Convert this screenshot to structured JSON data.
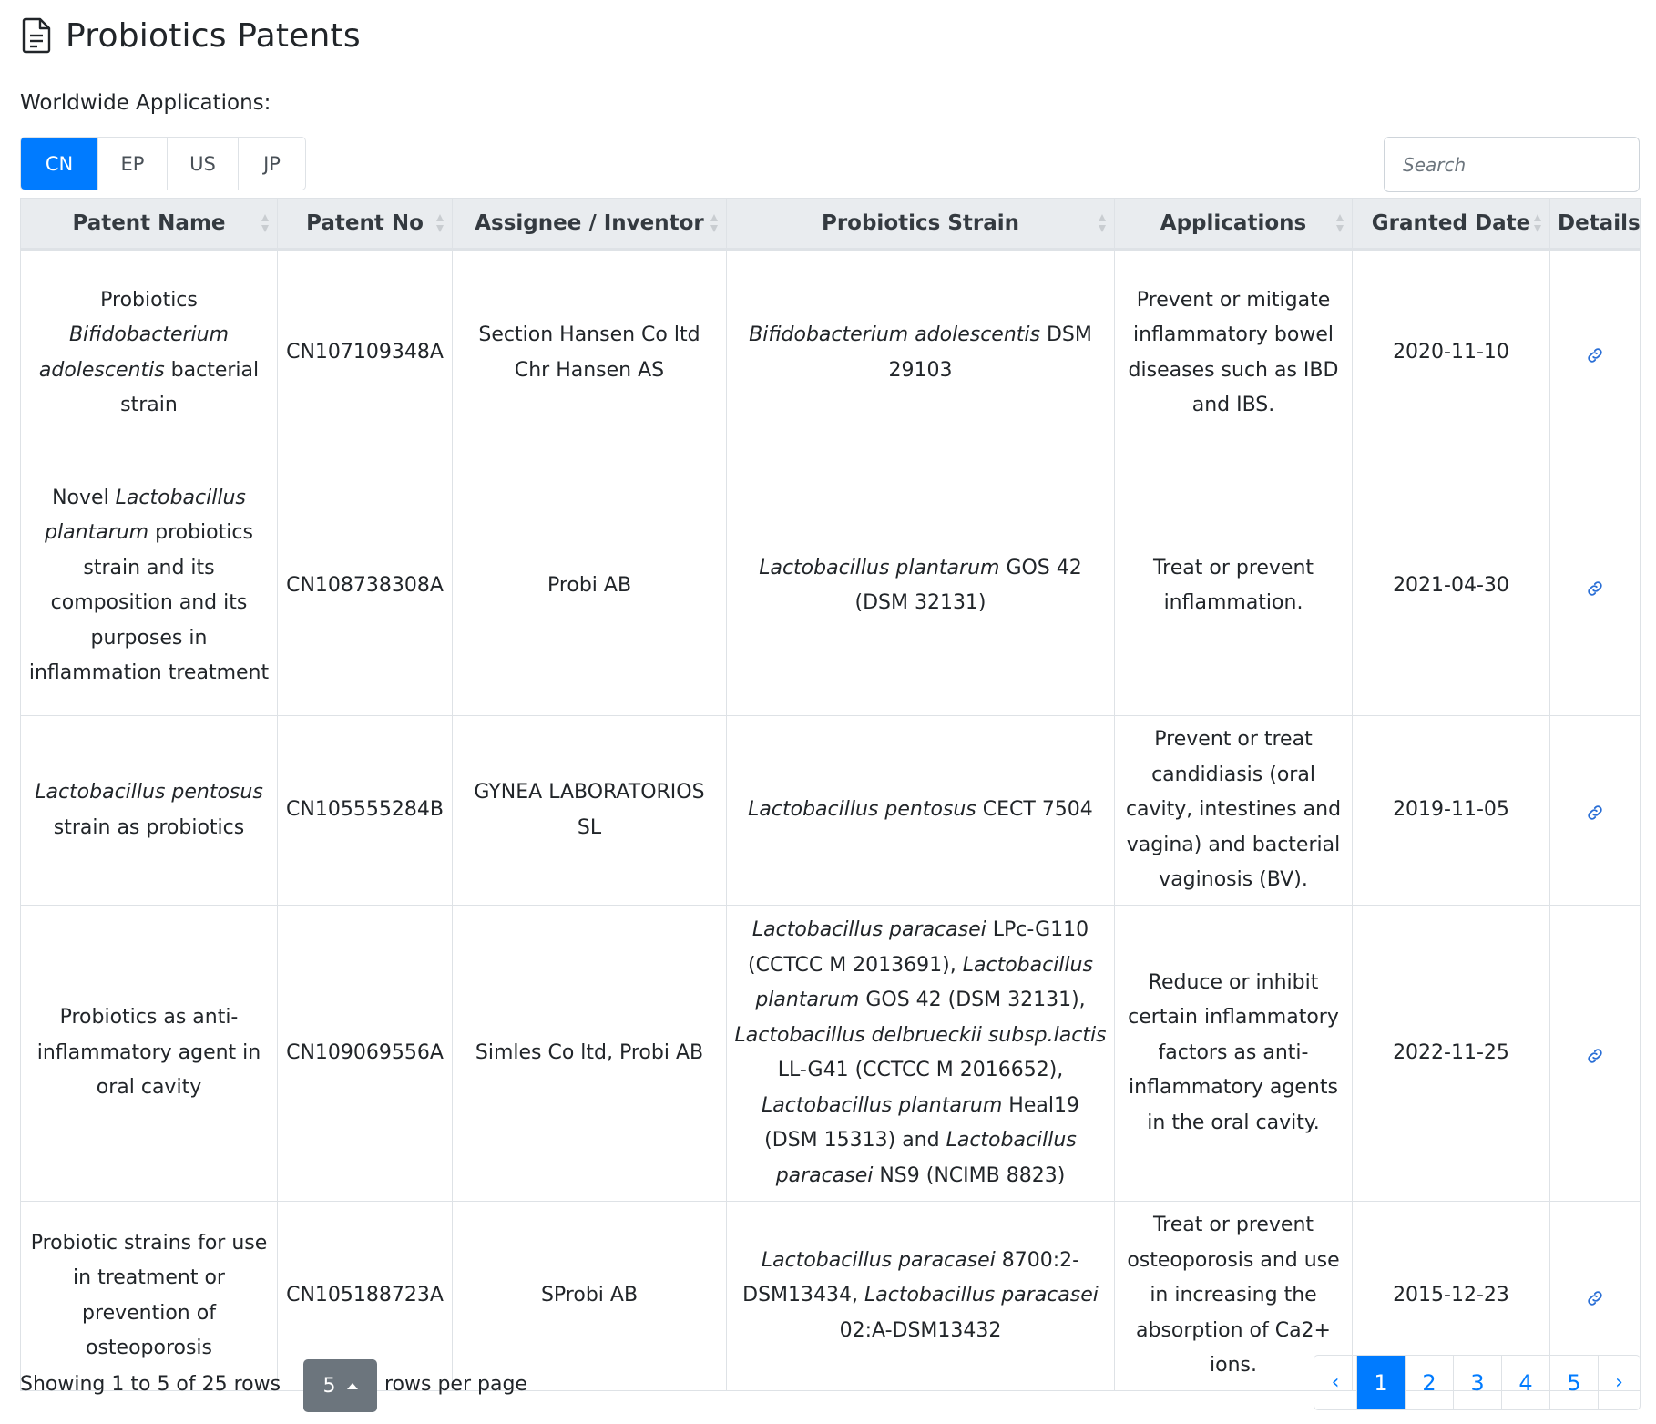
{
  "header": {
    "icon": "file-text-icon",
    "title": "Probiotics Patents",
    "subtitle": "Worldwide Applications:"
  },
  "region_tabs": [
    {
      "label": "CN",
      "active": true
    },
    {
      "label": "EP",
      "active": false
    },
    {
      "label": "US",
      "active": false
    },
    {
      "label": "JP",
      "active": false
    }
  ],
  "search": {
    "placeholder": "Search",
    "value": ""
  },
  "table": {
    "columns": [
      {
        "label": "Patent Name",
        "sortable": true
      },
      {
        "label": "Patent No",
        "sortable": true
      },
      {
        "label": "Assignee / Inventor",
        "sortable": true
      },
      {
        "label": "Probiotics Strain",
        "sortable": true
      },
      {
        "label": "Applications",
        "sortable": true
      },
      {
        "label": "Granted Date",
        "sortable": true
      },
      {
        "label": "Details",
        "sortable": false
      }
    ],
    "rows": [
      {
        "name": [
          {
            "t": "Probiotics ",
            "i": false
          },
          {
            "t": "Bifidobacterium adolescentis",
            "i": true
          },
          {
            "t": " bacterial strain",
            "i": false
          }
        ],
        "patent_no": "CN107109348A",
        "assignee": "Section Hansen Co ltd Chr Hansen AS",
        "strain": [
          {
            "t": "Bifidobacterium adolescentis",
            "i": true
          },
          {
            "t": " DSM 29103",
            "i": false
          }
        ],
        "applications": "Prevent or mitigate inflammatory bowel diseases such as IBD and IBS.",
        "granted_date": "2020-11-10",
        "details_icon": "link-icon"
      },
      {
        "name": [
          {
            "t": "Novel ",
            "i": false
          },
          {
            "t": "Lactobacillus plantarum",
            "i": true
          },
          {
            "t": " probiotics strain and its composition and its purposes in inflammation treatment",
            "i": false
          }
        ],
        "patent_no": "CN108738308A",
        "assignee": "Probi AB",
        "strain": [
          {
            "t": "Lactobacillus plantarum",
            "i": true
          },
          {
            "t": " GOS 42 (DSM 32131)",
            "i": false
          }
        ],
        "applications": "Treat or prevent inflammation.",
        "granted_date": "2021-04-30",
        "details_icon": "link-icon"
      },
      {
        "name": [
          {
            "t": "Lactobacillus pentosus",
            "i": true
          },
          {
            "t": " strain as probiotics",
            "i": false
          }
        ],
        "patent_no": "CN105555284B",
        "assignee": "GYNEA LABORATORIOS SL",
        "strain": [
          {
            "t": "Lactobacillus pentosus",
            "i": true
          },
          {
            "t": " CECT 7504",
            "i": false
          }
        ],
        "applications": "Prevent or treat candidiasis (oral cavity, intestines and vagina) and bacterial vaginosis (BV).",
        "granted_date": "2019-11-05",
        "details_icon": "link-icon"
      },
      {
        "name": [
          {
            "t": "Probiotics as anti-inflammatory agent in oral cavity",
            "i": false
          }
        ],
        "patent_no": "CN109069556A",
        "assignee": "Simles Co ltd, Probi AB",
        "strain": [
          {
            "t": "Lactobacillus paracasei",
            "i": true
          },
          {
            "t": " LPc-G110 (CCTCC M 2013691), ",
            "i": false
          },
          {
            "t": "Lactobacillus plantarum",
            "i": true
          },
          {
            "t": " GOS 42 (DSM 32131), ",
            "i": false
          },
          {
            "t": "Lactobacillus delbrueckii subsp.lactis",
            "i": true
          },
          {
            "t": " LL-G41 (CCTCC M 2016652), ",
            "i": false
          },
          {
            "t": "Lactobacillus plantarum",
            "i": true
          },
          {
            "t": " Heal19 (DSM 15313) and ",
            "i": false
          },
          {
            "t": "Lactobacillus paracasei",
            "i": true
          },
          {
            "t": " NS9 (NCIMB 8823)",
            "i": false
          }
        ],
        "applications": "Reduce or inhibit certain inflammatory factors as anti-inflammatory agents in the oral cavity.",
        "granted_date": "2022-11-25",
        "details_icon": "link-icon"
      },
      {
        "name": [
          {
            "t": "Probiotic strains for use in treatment or prevention of osteoporosis",
            "i": false
          }
        ],
        "patent_no": "CN105188723A",
        "assignee": "SProbi AB",
        "strain": [
          {
            "t": "Lactobacillus paracasei",
            "i": true
          },
          {
            "t": " 8700:2-DSM13434, ",
            "i": false
          },
          {
            "t": "Lactobacillus paracasei",
            "i": true
          },
          {
            "t": " 02:A-DSM13432",
            "i": false
          }
        ],
        "applications": "Treat or prevent osteoporosis and use in increasing the absorption of Ca2+ ions.",
        "granted_date": "2015-12-23",
        "details_icon": "link-icon"
      }
    ]
  },
  "footer": {
    "showing_text": "Showing 1 to 5 of 25 rows",
    "rows_per_page_value": "5",
    "rows_per_page_suffix": "rows per page",
    "pagination": {
      "prev": "‹",
      "pages": [
        "1",
        "2",
        "3",
        "4",
        "5"
      ],
      "active_page": "1",
      "next": "›"
    }
  },
  "colors": {
    "primary": "#007bff",
    "header_bg": "#e9ecef",
    "border": "#dee2e6",
    "secondary_button": "#6c757d"
  }
}
